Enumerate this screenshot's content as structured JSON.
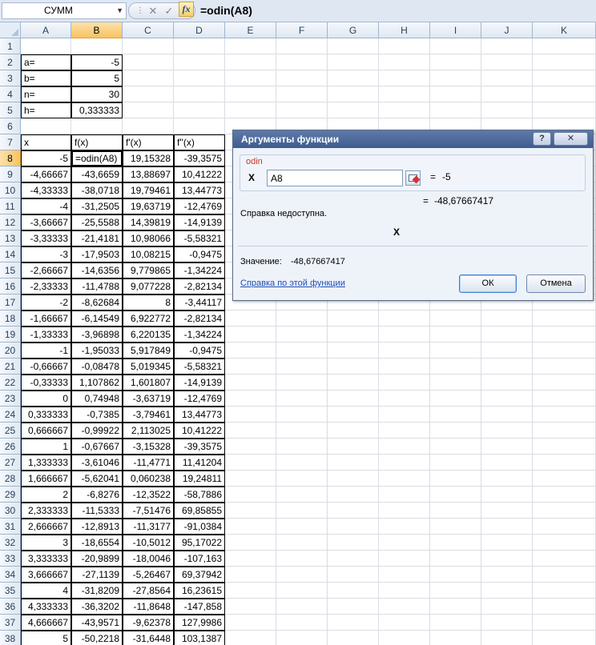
{
  "formula_bar": {
    "name_box": "СУММ",
    "name_box_arrow": "▼",
    "cancel_icon": "✕",
    "enter_icon": "✓",
    "fx_label": "fx",
    "formula": "=odin(A8)"
  },
  "columns": [
    "A",
    "B",
    "C",
    "D",
    "E",
    "F",
    "G",
    "H",
    "I",
    "J",
    "K"
  ],
  "rows": [
    "1",
    "2",
    "3",
    "4",
    "5",
    "6",
    "7",
    "8",
    "9",
    "10",
    "11",
    "12",
    "13",
    "14",
    "15",
    "16",
    "17",
    "18",
    "19",
    "20",
    "21",
    "22",
    "23",
    "24",
    "25",
    "26",
    "27",
    "28",
    "29",
    "30",
    "31",
    "32",
    "33",
    "34",
    "35",
    "36",
    "37",
    "38"
  ],
  "params": [
    {
      "label": "a=",
      "value": "-5"
    },
    {
      "label": "b=",
      "value": "5"
    },
    {
      "label": "n=",
      "value": "30"
    },
    {
      "label": "h=",
      "value": "0,333333"
    }
  ],
  "table_header": [
    "x",
    "f(x)",
    "f'(x)",
    "f''(x)"
  ],
  "table_rows": [
    [
      "-5",
      "=odin(A8)",
      "19,15328",
      "-39,3575"
    ],
    [
      "-4,66667",
      "-43,6659",
      "13,88697",
      "10,41222"
    ],
    [
      "-4,33333",
      "-38,0718",
      "19,79461",
      "13,44773"
    ],
    [
      "-4",
      "-31,2505",
      "19,63719",
      "-12,4769"
    ],
    [
      "-3,66667",
      "-25,5588",
      "14,39819",
      "-14,9139"
    ],
    [
      "-3,33333",
      "-21,4181",
      "10,98066",
      "-5,58321"
    ],
    [
      "-3",
      "-17,9503",
      "10,08215",
      "-0,9475"
    ],
    [
      "-2,66667",
      "-14,6356",
      "9,779865",
      "-1,34224"
    ],
    [
      "-2,33333",
      "-11,4788",
      "9,077228",
      "-2,82134"
    ],
    [
      "-2",
      "-8,62684",
      "8",
      "-3,44117"
    ],
    [
      "-1,66667",
      "-6,14549",
      "6,922772",
      "-2,82134"
    ],
    [
      "-1,33333",
      "-3,96898",
      "6,220135",
      "-1,34224"
    ],
    [
      "-1",
      "-1,95033",
      "5,917849",
      "-0,9475"
    ],
    [
      "-0,66667",
      "-0,08478",
      "5,019345",
      "-5,58321"
    ],
    [
      "-0,33333",
      "1,107862",
      "1,601807",
      "-14,9139"
    ],
    [
      "0",
      "0,74948",
      "-3,63719",
      "-12,4769"
    ],
    [
      "0,333333",
      "-0,7385",
      "-3,79461",
      "13,44773"
    ],
    [
      "0,666667",
      "-0,99922",
      "2,113025",
      "10,41222"
    ],
    [
      "1",
      "-0,67667",
      "-3,15328",
      "-39,3575"
    ],
    [
      "1,333333",
      "-3,61046",
      "-11,4771",
      "11,41204"
    ],
    [
      "1,666667",
      "-5,62041",
      "0,060238",
      "19,24811"
    ],
    [
      "2",
      "-6,8276",
      "-12,3522",
      "-58,7886"
    ],
    [
      "2,333333",
      "-11,5333",
      "-7,51476",
      "69,85855"
    ],
    [
      "2,666667",
      "-12,8913",
      "-11,3177",
      "-91,0384"
    ],
    [
      "3",
      "-18,6554",
      "-10,5012",
      "95,17022"
    ],
    [
      "3,333333",
      "-20,9899",
      "-18,0046",
      "-107,163"
    ],
    [
      "3,666667",
      "-27,1139",
      "-5,26467",
      "69,37942"
    ],
    [
      "4",
      "-31,8209",
      "-27,8564",
      "16,23615"
    ],
    [
      "4,333333",
      "-36,3202",
      "-11,8648",
      "-147,858"
    ],
    [
      "4,666667",
      "-43,9571",
      "-9,62378",
      "127,9986"
    ],
    [
      "5",
      "-50,2218",
      "-31,6448",
      "103,1387"
    ]
  ],
  "dialog": {
    "title": "Аргументы функции",
    "help_btn": "?",
    "close_btn": "✕",
    "function_name": "odin",
    "arg_name": "X",
    "arg_value": "A8",
    "eq": "=",
    "arg_result": "-5",
    "result": "-48,67667417",
    "help_unavailable": "Справка недоступна.",
    "arg_hint": "X",
    "value_label": "Значение:",
    "value": "-48,67667417",
    "help_link": "Справка по этой функции",
    "ok": "ОК",
    "cancel": "Отмена"
  }
}
